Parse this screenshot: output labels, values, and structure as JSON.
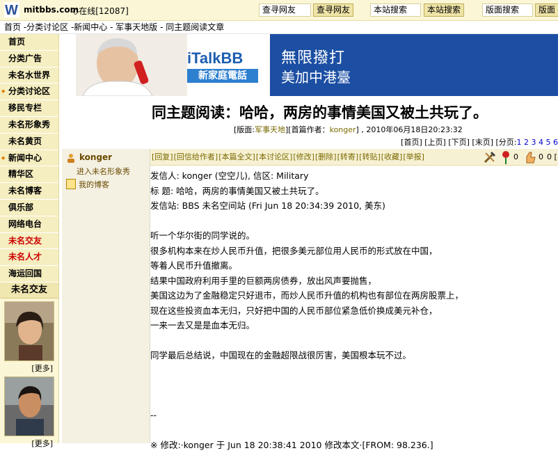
{
  "header": {
    "site_name": "mitbbs.com",
    "online": "◇在线[12087]",
    "search_friend_box": "查寻网友",
    "search_friend_btn": "查寻网友",
    "site_search_box": "本站搜索",
    "site_search_btn": "本站搜索",
    "board_search_box": "版面搜索",
    "board_search_btn": "版面搜"
  },
  "breadcrumb": "首页 -分类讨论区 -新闻中心 - 军事天地版 - 同主题阅读文章",
  "sidebar": {
    "items": [
      {
        "label": "首页"
      },
      {
        "label": "分类广告"
      },
      {
        "label": "未名水世界"
      },
      {
        "label": "分类讨论区"
      },
      {
        "label": "移民专栏"
      },
      {
        "label": "未名形象秀"
      },
      {
        "label": "未名黄页"
      },
      {
        "label": "新闻中心"
      },
      {
        "label": "精华区"
      },
      {
        "label": "未名博客"
      },
      {
        "label": "俱乐部"
      },
      {
        "label": "网络电台"
      },
      {
        "label": "未名交友"
      },
      {
        "label": "未名人才"
      },
      {
        "label": "海运回国"
      }
    ],
    "friends_title": "未名交友",
    "more1": "[更多]",
    "more2": "[更多]"
  },
  "banner": {
    "brand": "iTalkBB",
    "brand_sub": "新家庭電話",
    "slogan1": "無限撥打",
    "slogan2": "美加中港臺"
  },
  "article": {
    "title": "同主题阅读：哈哈，两房的事情美国又被土共玩了。",
    "info_prefix": "[版面:",
    "board": "军事天地",
    "info_mid": "][首篇作者：",
    "first_author": "konger",
    "info_suffix": "] , 2010年06月18日20:23:32",
    "pager_text": "[首页] [上页] [下页] [末页] [分页:",
    "pages": [
      "1",
      "2",
      "3",
      "4",
      "5",
      "6"
    ]
  },
  "author": {
    "name": "konger",
    "image_show": "进入未名形象秀",
    "blog": "我的博客"
  },
  "actions": [
    "[回复]",
    "[回信给作者]",
    "[本篇全文]",
    "[本讨论区]",
    "[修改]",
    "[删除]",
    "[转寄]",
    "[转贴]",
    "[收藏]",
    "[举报]"
  ],
  "reactions": {
    "flower": "0",
    "egg": "0",
    "count": "0 [1"
  },
  "post": {
    "lines": [
      "发信人: konger (空空儿), 信区: Military",
      "标  题: 哈哈，两房的事情美国又被土共玩了。",
      "发信站: BBS 未名空间站  (Fri Jun 18 20:34:39 2010, 美东)",
      "",
      "听一个华尔街的同学说的。",
      "很多机构本来在炒人民币升值，把很多美元部位用人民币的形式放在中国，",
      "等着人民币升值撤离。",
      "结果中国政府利用手里的巨额两房债券，放出风声要抛售，",
      "美国这边为了金融稳定只好退市，而炒人民币升值的机构也有部位在两房股票上，",
      "现在这些投资血本无归，只好把中国的人民币部位紧急低价换成美元补仓，",
      "一来一去又是是血本无归。",
      "",
      "同学最后总结说，中国现在的金融超限战很厉害，美国根本玩不过。",
      "",
      "",
      "",
      "--",
      "",
      "※ 修改:·konger 于  Jun 18 20:38:41 2010 修改本文·[FROM: 98.236.]"
    ]
  },
  "colors": {
    "accent": "#c00000",
    "sidebar_bg": "#fbf6d6",
    "banner_blue": "#1c4fa3"
  }
}
